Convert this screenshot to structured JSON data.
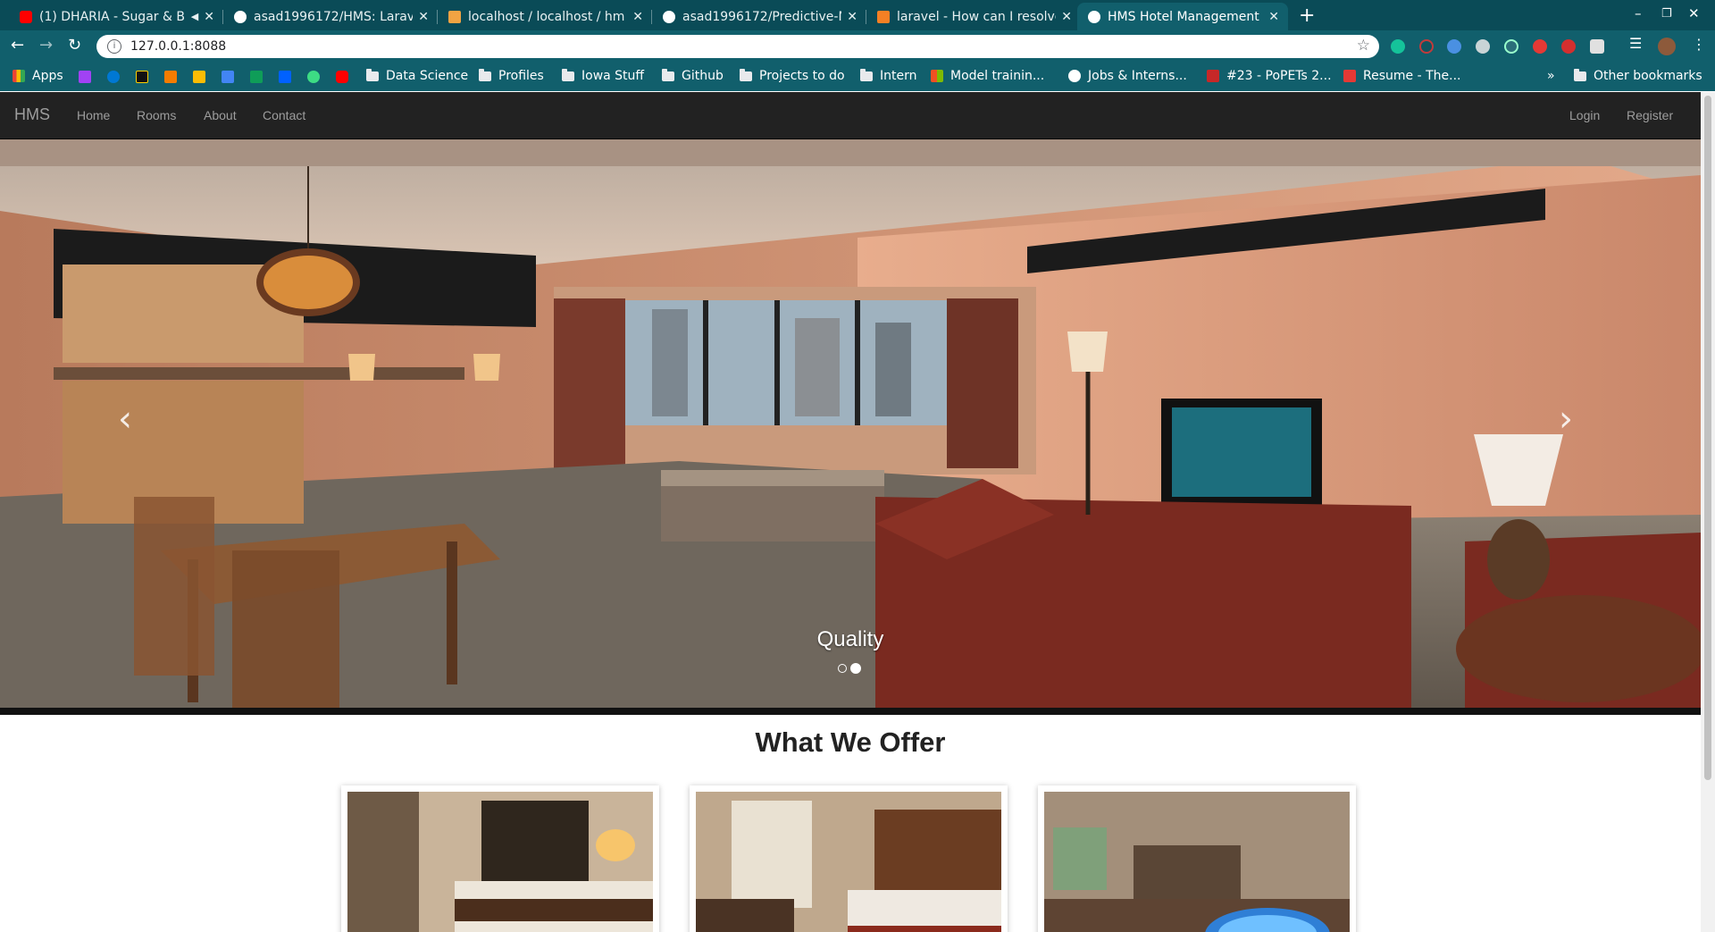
{
  "browser": {
    "tabs": [
      {
        "title": "(1) DHARIA - Sugar & B",
        "favicon_color": "#ff0000",
        "active": false
      },
      {
        "title": "asad1996172/HMS: Larav",
        "favicon_color": "#ffffff",
        "active": false
      },
      {
        "title": "localhost / localhost / hm",
        "favicon_color": "#f1a343",
        "active": false
      },
      {
        "title": "asad1996172/Predictive-N",
        "favicon_color": "#ffffff",
        "active": false
      },
      {
        "title": "laravel - How can I resolve",
        "favicon_color": "#f48024",
        "active": false
      },
      {
        "title": "HMS Hotel Management S",
        "favicon_color": "#ffffff",
        "active": true
      }
    ],
    "new_tab_label": "+",
    "address": "127.0.0.1:8088",
    "bookmarks": {
      "apps_label": "Apps",
      "items": [
        "Data Science",
        "Profiles",
        "Iowa Stuff",
        "Github",
        "Projects to do",
        "Intern",
        "Model trainin...",
        "Jobs & Interns...",
        "#23 - PoPETs 2...",
        "Resume - The..."
      ],
      "overflow_label": "»",
      "other_label": "Other bookmarks"
    }
  },
  "site": {
    "brand": "HMS",
    "nav_left": [
      "Home",
      "Rooms",
      "About",
      "Contact"
    ],
    "nav_right": [
      "Login",
      "Register"
    ],
    "carousel": {
      "caption": "Quality",
      "slides": 2,
      "active_slide": 2,
      "prev_icon": "chevron-left-icon",
      "next_icon": "chevron-right-icon"
    },
    "offer_title": "What We Offer"
  },
  "colors": {
    "chrome_dark": "#0a4b57",
    "chrome": "#115f6c",
    "navbar": "#222222",
    "nav_text": "#9d9d9d"
  }
}
